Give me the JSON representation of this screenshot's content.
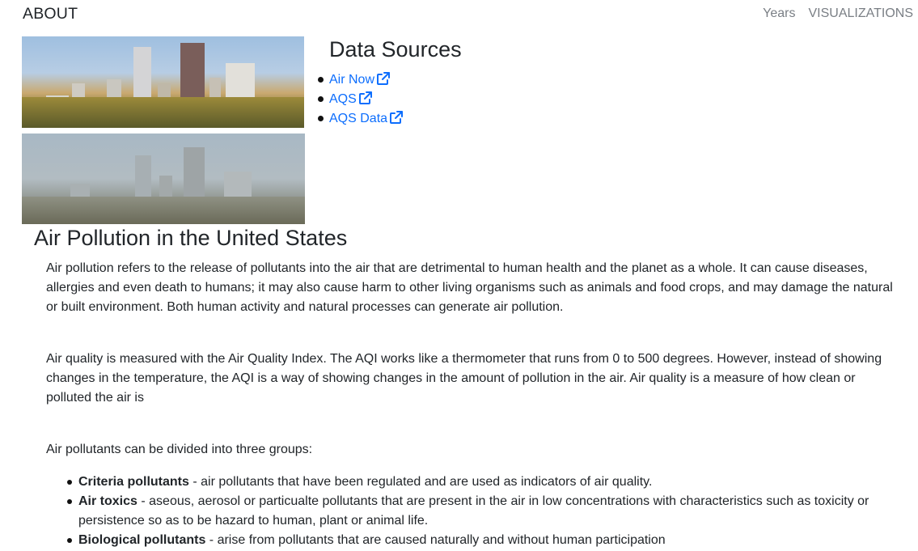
{
  "nav": {
    "brand": "ABOUT",
    "links": [
      "Years",
      "VISUALIZATIONS"
    ]
  },
  "data_sources": {
    "title": "Data Sources",
    "links": [
      "Air Now",
      "AQS",
      "AQS Data"
    ]
  },
  "main": {
    "title": "Air Pollution in the United States",
    "paragraphs": [
      "Air pollution refers to the release of pollutants into the air that are detrimental to human health and the planet as a whole. It can cause diseases, allergies and even death to humans; it may also cause harm to other living organisms such as animals and food crops, and may damage the natural or built environment. Both human activity and natural processes can generate air pollution.",
      "Air quality is measured with the Air Quality Index. The AQI works like a thermometer that runs from 0 to 500 degrees. However, instead of showing changes in the temperature, the AQI is a way of showing changes in the amount of pollution in the air. Air quality is a measure of how clean or polluted the air is",
      "Air pollutants can be divided into three groups:"
    ],
    "groups": [
      {
        "term": "Criteria pollutants",
        "desc": " - air pollutants that have been regulated and are used as indicators of air quality."
      },
      {
        "term": "Air toxics",
        "desc": " - aseous, aerosol or particualte pollutants that are present in the air in low concentrations with characteristics such as toxicity or persistence so as to be hazard to human, plant or animal life."
      },
      {
        "term": "Biological pollutants",
        "desc": " - arise from pollutants that are caused naturally and without human participation"
      }
    ]
  },
  "colors": {
    "link": "#0d6efd",
    "nav_link": "#7a7f85",
    "text": "#212529"
  },
  "icons": {
    "external_link": "external-link-icon"
  }
}
